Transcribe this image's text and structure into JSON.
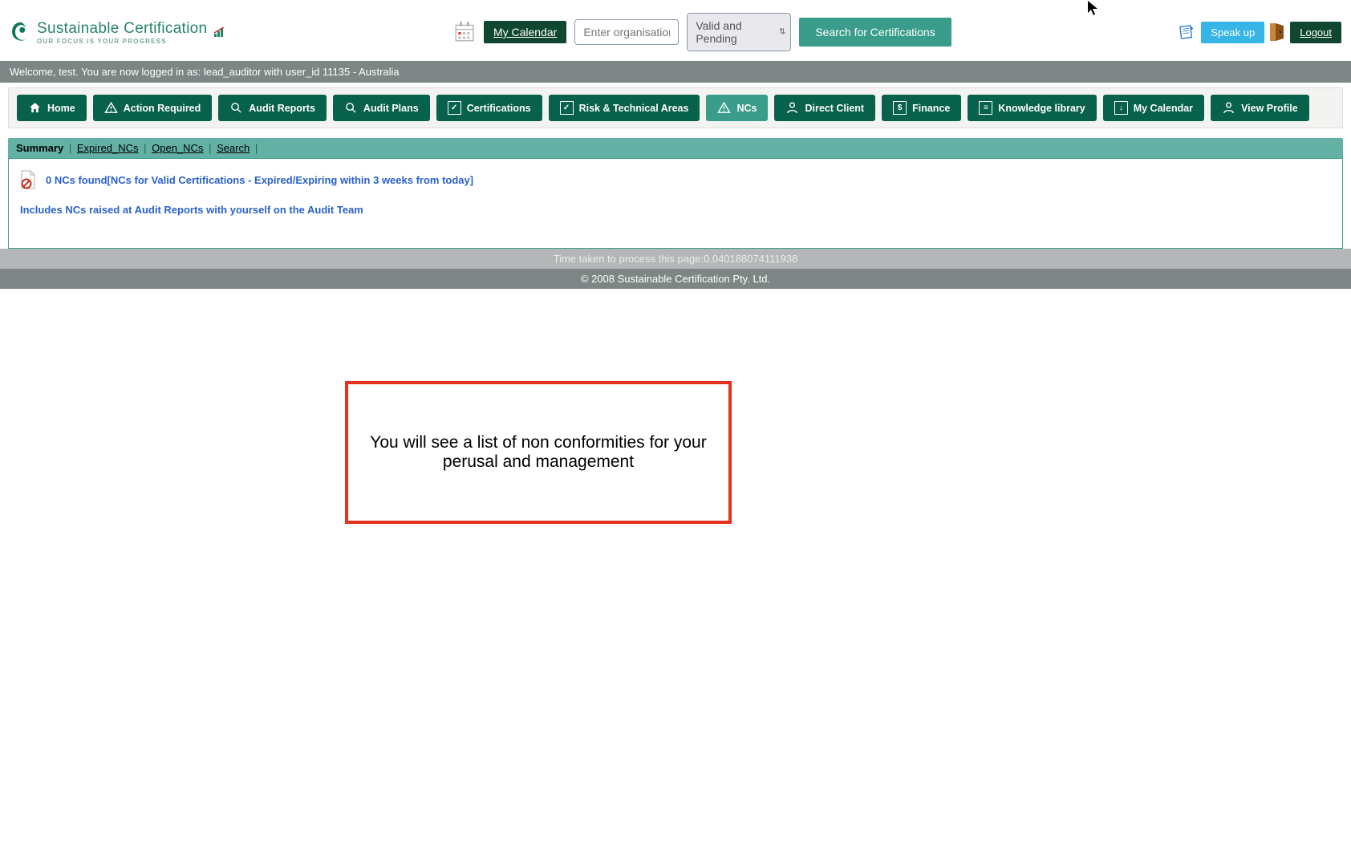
{
  "header": {
    "logo_main": "Sustainable Certification",
    "logo_tag": "OUR FOCUS IS YOUR PROGRESS",
    "my_calendar": "My Calendar",
    "org_placeholder": "Enter organisation na",
    "status_selected": "Valid and Pending",
    "search_cert": "Search for Certifications",
    "speak_up": "Speak up",
    "logout": "Logout"
  },
  "welcome": "Welcome, test. You are now logged in as: lead_auditor with user_id 11135 - Australia",
  "nav": {
    "home": "Home",
    "action_required": "Action Required",
    "audit_reports": "Audit Reports",
    "audit_plans": "Audit Plans",
    "certifications": "Certifications",
    "risk_tech": "Risk & Technical Areas",
    "ncs": "NCs",
    "direct_client": "Direct Client",
    "finance": "Finance",
    "knowledge": "Knowledge library",
    "my_calendar": "My Calendar",
    "view_profile": "View Profile"
  },
  "tabs": {
    "summary": "Summary",
    "expired": "Expired_NCs",
    "open": "Open_NCs",
    "search": "Search"
  },
  "content": {
    "ncs_found": "0 NCs found[NCs for Valid Certifications - Expired/Expiring within 3 weeks from today]",
    "includes": "Includes NCs raised at Audit Reports with yourself on the Audit Team"
  },
  "footer": {
    "time": "Time taken to process this page:0.040188074111938",
    "copy": "© 2008 Sustainable Certification Pty. Ltd."
  },
  "annotation": "You will see a list of non conformities  for your perusal and management"
}
